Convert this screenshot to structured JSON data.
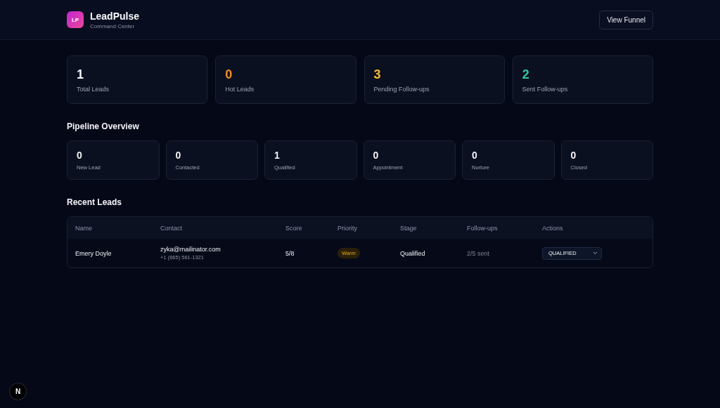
{
  "header": {
    "logo": "LP",
    "title": "LeadPulse",
    "subtitle": "Command Center",
    "button": "View Funnel"
  },
  "stats": [
    {
      "value": "1",
      "label": "Total Leads",
      "color": "#f3f4f6"
    },
    {
      "value": "0",
      "label": "Hot Leads",
      "color": "#f28c28"
    },
    {
      "value": "3",
      "label": "Pending Follow-ups",
      "color": "#f5b82e"
    },
    {
      "value": "2",
      "label": "Sent Follow-ups",
      "color": "#2fc9a0"
    }
  ],
  "pipeline": {
    "title": "Pipeline Overview",
    "stages": [
      {
        "value": "0",
        "label": "New Lead"
      },
      {
        "value": "0",
        "label": "Contacted"
      },
      {
        "value": "1",
        "label": "Qualified"
      },
      {
        "value": "0",
        "label": "Appointment"
      },
      {
        "value": "0",
        "label": "Nurture"
      },
      {
        "value": "0",
        "label": "Closed"
      }
    ]
  },
  "recent": {
    "title": "Recent Leads",
    "columns": [
      "Name",
      "Contact",
      "Score",
      "Priority",
      "Stage",
      "Follow-ups",
      "Actions"
    ],
    "rows": [
      {
        "name": "Emery Doyle",
        "email": "zyka@mailinator.com",
        "phone": "+1 (665) 561-1321",
        "score": "5/8",
        "priority": "Warm",
        "stage": "Qualified",
        "followups": "2/5 sent",
        "action": "QUALIFIED"
      }
    ]
  },
  "dev_badge": "N"
}
